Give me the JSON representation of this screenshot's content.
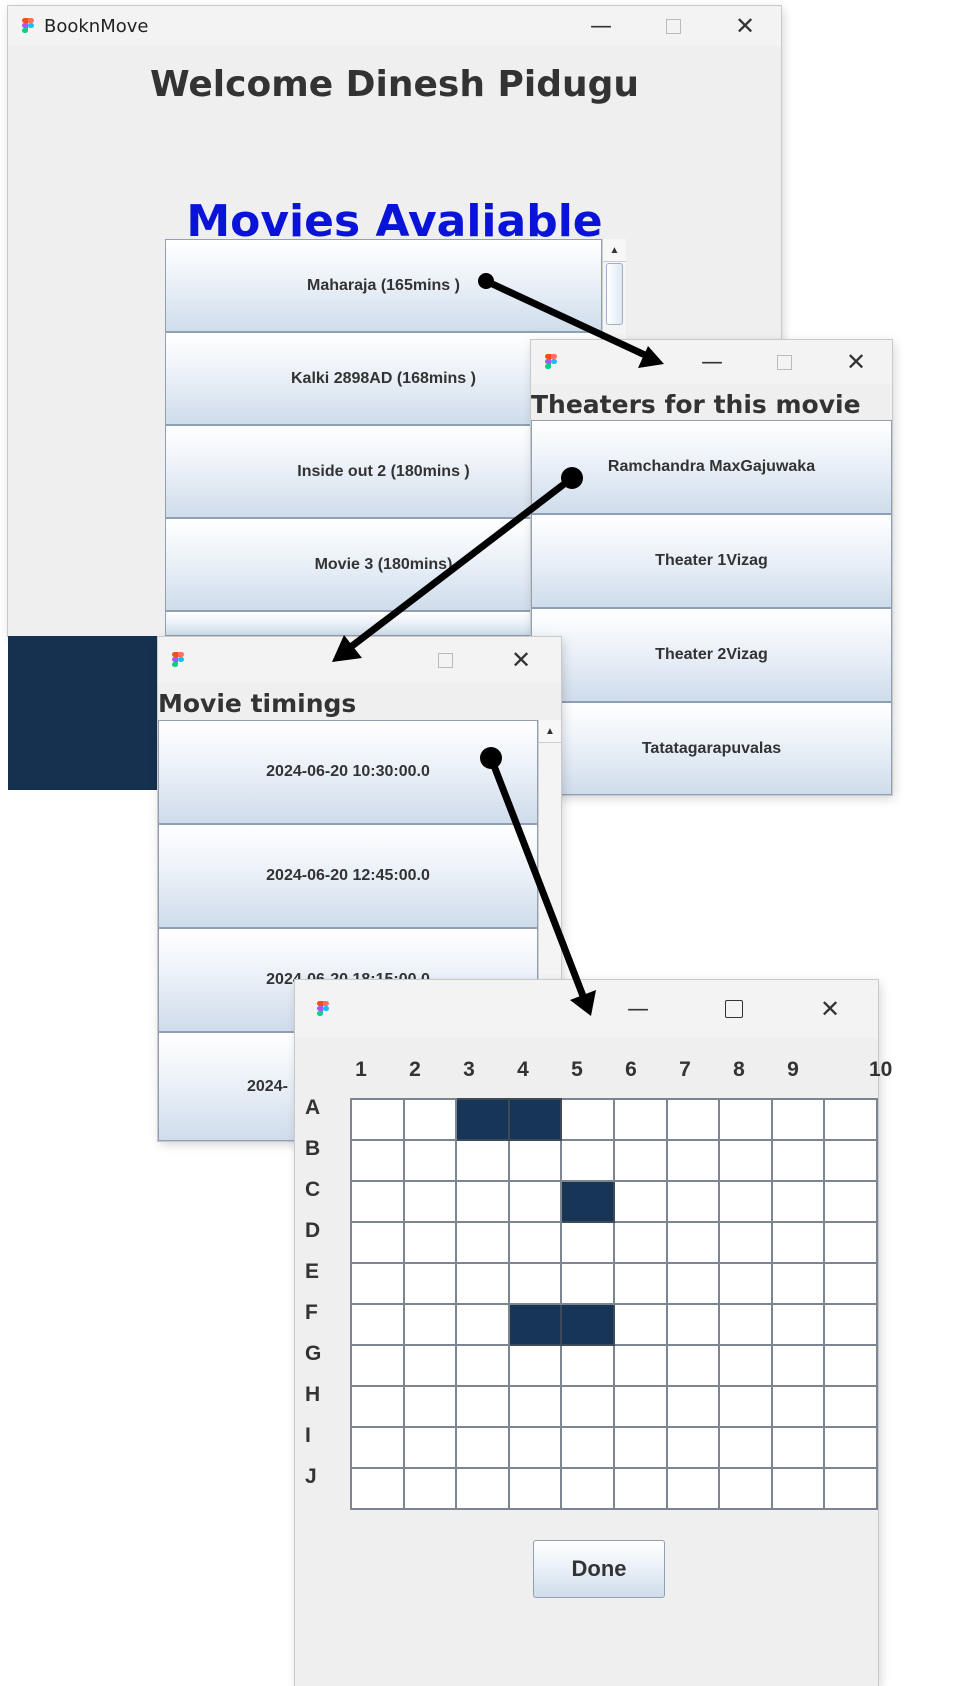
{
  "main_window": {
    "app_title": "BooknMove",
    "welcome": "Welcome Dinesh Pidugu",
    "movies_heading": "Movies Avaliable",
    "movies": [
      {
        "label": "Maharaja (165mins )"
      },
      {
        "label": "Kalki 2898AD (168mins )"
      },
      {
        "label": "Inside out 2 (180mins )"
      },
      {
        "label": "Movie 3 (180mins)"
      }
    ]
  },
  "theaters_window": {
    "heading": "Theaters for this movie",
    "theaters": [
      {
        "label": "Ramchandra MaxGajuwaka"
      },
      {
        "label": "Theater 1Vizag"
      },
      {
        "label": "Theater 2Vizag"
      },
      {
        "label": "Tatatagarapuvalas"
      }
    ]
  },
  "timings_window": {
    "heading": "Movie timings",
    "timings": [
      {
        "label": "2024-06-20 10:30:00.0"
      },
      {
        "label": "2024-06-20 12:45:00.0"
      },
      {
        "label": "2024-06-20 18:15:00.0"
      },
      {
        "label": "2024-"
      }
    ]
  },
  "seats_window": {
    "columns": [
      "1",
      "2",
      "3",
      "4",
      "5",
      "6",
      "7",
      "8",
      "9",
      "10"
    ],
    "rows": [
      "A",
      "B",
      "C",
      "D",
      "E",
      "F",
      "G",
      "H",
      "I",
      "J"
    ],
    "booked": [
      "A3",
      "A4",
      "C5",
      "F4",
      "F5"
    ],
    "done_label": "Done"
  },
  "colors": {
    "accent_heading": "#0a14d8",
    "booked_seat": "#173557",
    "dark_band": "#15314f"
  },
  "icons": {
    "app": "figma-style-app-icon",
    "minimize": "minimize-icon",
    "maximize": "maximize-icon",
    "close": "close-icon"
  }
}
